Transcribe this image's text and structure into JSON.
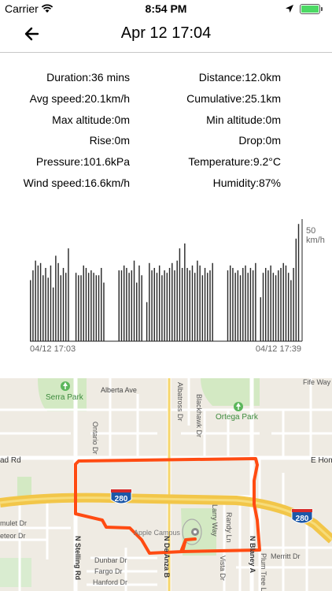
{
  "status_bar": {
    "carrier": "Carrier",
    "time": "8:54 PM"
  },
  "nav": {
    "title": "Apr 12 17:04"
  },
  "stats": {
    "duration": "Duration:36 mins",
    "distance": "Distance:12.0km",
    "avg_speed": "Avg speed:20.1km/h",
    "cumulative": "Cumulative:25.1km",
    "max_altitude": "Max altitude:0m",
    "min_altitude": "Min altitude:0m",
    "rise": "Rise:0m",
    "drop": "Drop:0m",
    "pressure": "Pressure:101.6kPa",
    "temperature": "Temperature:9.2°C",
    "wind_speed": "Wind speed:16.6km/h",
    "humidity": "Humidity:87%"
  },
  "chart_data": {
    "type": "bar",
    "y_max_label": "50",
    "y_unit": "km/h",
    "x_start_label": "04/12 17:03",
    "x_end_label": "04/12 17:39",
    "ylim": [
      0,
      50
    ],
    "values": [
      25,
      29,
      33,
      31,
      32,
      27,
      30,
      26,
      31,
      22,
      35,
      32,
      27,
      30,
      28,
      38,
      0,
      0,
      28,
      27,
      27,
      31,
      30,
      28,
      29,
      28,
      27,
      27,
      30,
      24,
      0,
      0,
      0,
      0,
      0,
      29,
      29,
      31,
      30,
      28,
      29,
      33,
      24,
      31,
      27,
      0,
      16,
      32,
      29,
      30,
      28,
      31,
      27,
      29,
      28,
      30,
      32,
      29,
      33,
      38,
      30,
      40,
      30,
      29,
      31,
      28,
      33,
      31,
      27,
      30,
      28,
      29,
      32,
      0,
      0,
      0,
      0,
      0,
      29,
      31,
      30,
      28,
      29,
      27,
      30,
      31,
      28,
      30,
      29,
      32,
      0,
      18,
      28,
      30,
      29,
      31,
      28,
      27,
      29,
      30,
      32,
      31,
      28,
      25,
      30,
      42,
      48
    ]
  },
  "colors": {
    "bar": "#2b2b2b",
    "route": "#ff4b12",
    "highway": "#f5c542",
    "map_bg": "#efebe3",
    "park": "#cfe8c0"
  },
  "map": {
    "labels": {
      "serra_park": "Serra Park",
      "alberta_ave": "Alberta Ave",
      "albatross_dr": "Albatross Dr",
      "blackhawk_dr": "Blackhawk Dr",
      "fife_way": "Fife Way",
      "ortega_park": "Ortega Park",
      "ontario_dr": "Ontario Dr",
      "ad_rd": "ad Rd",
      "e_hom": "E Hom",
      "shield_280_a": "280",
      "shield_280_b": "280",
      "apple_campus": "Apple Campus",
      "larry_way": "Larry Way",
      "randy_ln": "Randy Ln",
      "mulet_dr": "mulet Dr",
      "eteor_dr": "eteor Dr",
      "stelling_rd": "N Stelling Rd",
      "de_anza_blvd": "N De Anza B",
      "blaney_ave": "N Blaney A",
      "dunbar_dr": "Dunbar Dr",
      "fargo_dr": "Fargo Dr",
      "hanford_dr": "Hanford Dr",
      "merritt_dr": "Merritt Dr",
      "vista_dr": "Vista Dr",
      "plum_tree": "Plum Tree L"
    }
  }
}
